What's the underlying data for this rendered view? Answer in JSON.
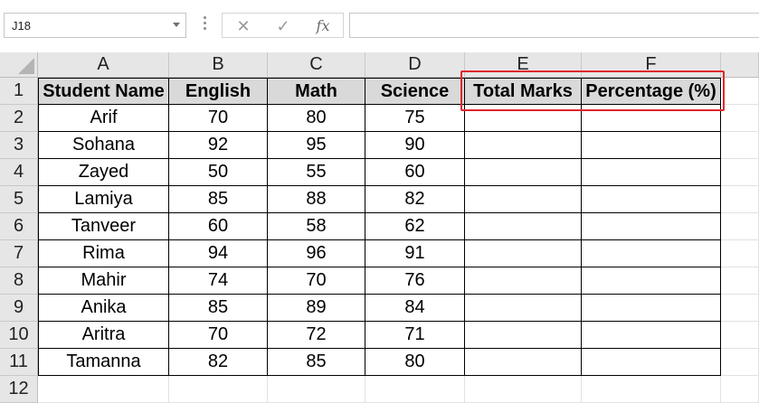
{
  "formula_bar": {
    "name_box": "J18",
    "cancel_icon": "✕",
    "enter_icon": "✓",
    "fx_label": "fx",
    "formula": ""
  },
  "columns": [
    "A",
    "B",
    "C",
    "D",
    "E",
    "F"
  ],
  "rows": [
    "1",
    "2",
    "3",
    "4",
    "5",
    "6",
    "7",
    "8",
    "9",
    "10",
    "11",
    "12"
  ],
  "table": {
    "headers": [
      "Student Name",
      "English",
      "Math",
      "Science",
      "Total Marks",
      "Percentage (%)"
    ],
    "records": [
      [
        "Arif",
        "70",
        "80",
        "75",
        "",
        ""
      ],
      [
        "Sohana",
        "92",
        "95",
        "90",
        "",
        ""
      ],
      [
        "Zayed",
        "50",
        "55",
        "60",
        "",
        ""
      ],
      [
        "Lamiya",
        "85",
        "88",
        "82",
        "",
        ""
      ],
      [
        "Tanveer",
        "60",
        "58",
        "62",
        "",
        ""
      ],
      [
        "Rima",
        "94",
        "96",
        "91",
        "",
        ""
      ],
      [
        "Mahir",
        "74",
        "70",
        "76",
        "",
        ""
      ],
      [
        "Anika",
        "85",
        "89",
        "84",
        "",
        ""
      ],
      [
        "Aritra",
        "70",
        "72",
        "71",
        "",
        ""
      ],
      [
        "Tamanna",
        "82",
        "85",
        "80",
        "",
        ""
      ]
    ]
  },
  "colors": {
    "highlight_border": "#e0262b",
    "header_fill": "#d9d9d9",
    "sheet_header_fill": "#e6e6e6"
  }
}
